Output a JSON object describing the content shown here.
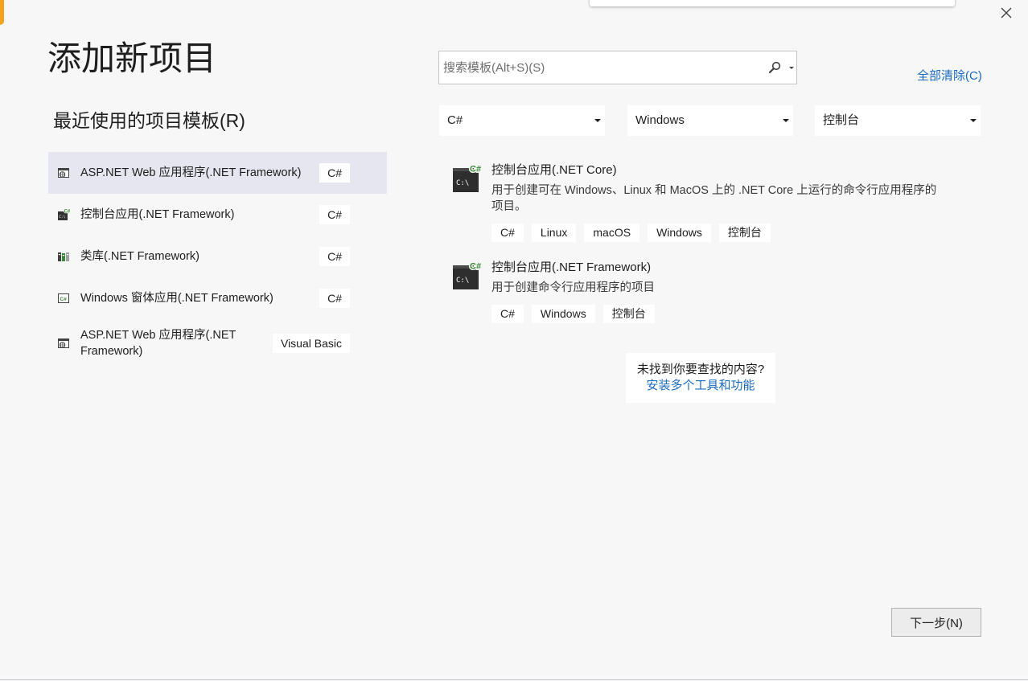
{
  "dialog": {
    "title": "添加新项目"
  },
  "search": {
    "placeholder": "搜索模板(Alt+S)(S)",
    "value": ""
  },
  "clear_all_label": "全部清除(C)",
  "recent": {
    "heading": "最近使用的项目模板(R)",
    "items": [
      {
        "label": "ASP.NET Web 应用程序(.NET Framework)",
        "language": "C#",
        "icon": "web-app-icon",
        "selected": true
      },
      {
        "label": "控制台应用(.NET Framework)",
        "language": "C#",
        "icon": "console-app-icon",
        "selected": false
      },
      {
        "label": "类库(.NET Framework)",
        "language": "C#",
        "icon": "class-library-icon",
        "selected": false
      },
      {
        "label": "Windows 窗体应用(.NET Framework)",
        "language": "C#",
        "icon": "windows-forms-icon",
        "selected": false
      },
      {
        "label": "ASP.NET Web 应用程序(.NET Framework)",
        "language": "Visual Basic",
        "icon": "web-app-icon",
        "selected": false
      }
    ]
  },
  "filters": {
    "language": {
      "selected": "C#"
    },
    "platform": {
      "selected": "Windows"
    },
    "project_type": {
      "selected": "控制台"
    }
  },
  "results": [
    {
      "title": "控制台应用(.NET Core)",
      "description": "用于创建可在 Windows、Linux 和 MacOS 上的 .NET Core 上运行的命令行应用程序的项目。",
      "icon": "console-app-icon",
      "tags": [
        "C#",
        "Linux",
        "macOS",
        "Windows",
        "控制台"
      ]
    },
    {
      "title": "控制台应用(.NET Framework)",
      "description": "用于创建命令行应用程序的项目",
      "icon": "console-app-icon",
      "tags": [
        "C#",
        "Windows",
        "控制台"
      ]
    }
  ],
  "not_found": {
    "question": "未找到你要查找的内容?",
    "install_link": "安装多个工具和功能"
  },
  "next_button_label": "下一步(N)",
  "icon_glyphs": {
    "console_prompt": "C:\\",
    "csharp_mark": "C#"
  },
  "icons": {
    "close": "close-icon",
    "search": "search-icon",
    "search_options": "chevron-down-icon",
    "dropdown": "chevron-down-icon"
  },
  "colors": {
    "page_background": "#f7f7f7",
    "selected_row": "#e5e6ef",
    "link": "#1a6bbf",
    "csharp_green": "#388a34",
    "window_accent": "#f6a11d"
  }
}
